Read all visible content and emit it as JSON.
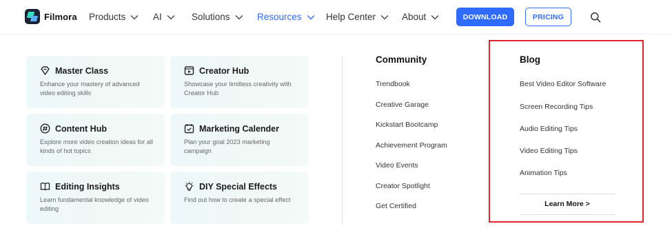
{
  "brand": {
    "name": "Filmora"
  },
  "nav": {
    "items": [
      {
        "label": "Products"
      },
      {
        "label": "AI"
      },
      {
        "label": "Solutions"
      },
      {
        "label": "Resources"
      },
      {
        "label": "Help Center"
      },
      {
        "label": "About"
      }
    ],
    "active": "Resources",
    "active_color": "#2f6bff",
    "download_label": "DOWNLOAD",
    "pricing_label": "PRICING"
  },
  "cards": [
    {
      "title": "Master Class",
      "desc": "Enhance your mastery of advanced video editing skills",
      "icon": "diamond-heart-icon"
    },
    {
      "title": "Creator Hub",
      "desc": "Showcase your limitless creativity with Creator Hub",
      "icon": "video-player-icon"
    },
    {
      "title": "Content Hub",
      "desc": "Explore more video creation ideas for all kinds of hot topics",
      "icon": "hashtag-icon"
    },
    {
      "title": "Marketing Calender",
      "desc": "Plan your goal 2023 marketing campaign",
      "icon": "calendar-check-icon"
    },
    {
      "title": "Editing Insights",
      "desc": "Learn fundamental knowledge of video editing",
      "icon": "open-book-icon"
    },
    {
      "title": "DIY Special Effects",
      "desc": "Find out how to create a special effect",
      "icon": "lightbulb-icon"
    }
  ],
  "community": {
    "title": "Community",
    "links": [
      "Trendbook",
      "Creative Garage",
      "Kickstart Bootcamp",
      "Achievement Program",
      "Video Events",
      "Creator Spotlight",
      "Get Certified"
    ]
  },
  "blog": {
    "title": "Blog",
    "links": [
      "Best Video Editor Software",
      "Screen Recording Tips",
      "Audio Editing Tips",
      "Video Editing Tips",
      "Animation Tips"
    ],
    "learn_more": "Learn More >",
    "highlight_color": "#e0242a"
  }
}
